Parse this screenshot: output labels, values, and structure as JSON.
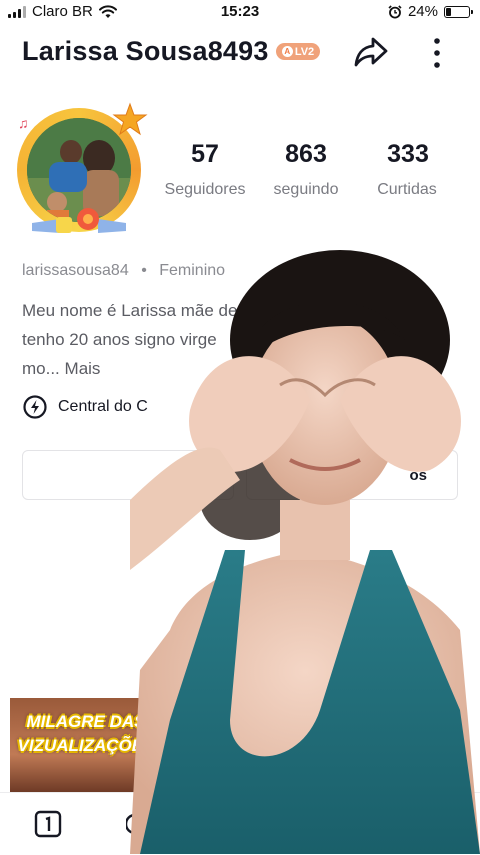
{
  "status_bar": {
    "carrier": "Claro BR",
    "time": "15:23",
    "battery": "24%",
    "battery_level": 0.24
  },
  "header": {
    "username": "Larissa Sousa8493",
    "level": "LV2"
  },
  "stats": [
    {
      "value": "57",
      "label": "Seguidores"
    },
    {
      "value": "863",
      "label": "seguindo"
    },
    {
      "value": "333",
      "label": "Curtidas"
    }
  ],
  "profile": {
    "handle": "larissasousa84",
    "separator": "•",
    "gender": "Feminino",
    "bio_line1": "Meu nome é Larissa mãe de",
    "bio_line2": "tenho 20 anos signo virge",
    "bio_line3": "mo...",
    "bio_more": "Mais",
    "central": "Central do C",
    "button_partial": "os"
  },
  "thumbnail": {
    "line1": "MILAGRE DAS",
    "line2": "VIZUALIZAÇÕES"
  },
  "colors": {
    "accent_level": "#f0a27a",
    "ring": "#f7c43d",
    "tank_top": "#1f6e7a"
  }
}
